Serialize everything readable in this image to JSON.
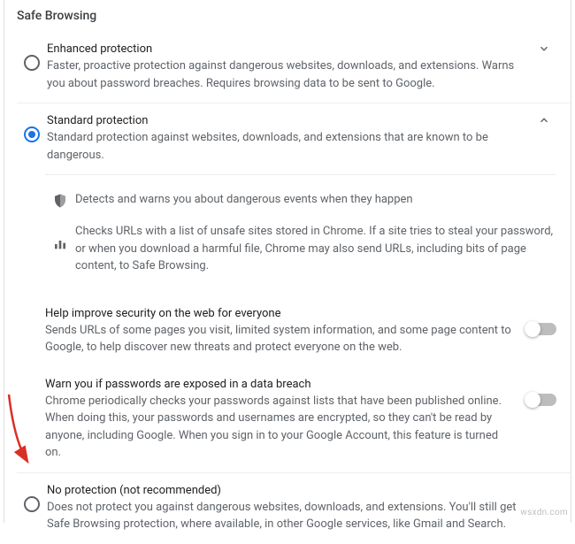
{
  "section_title": "Safe Browsing",
  "options": {
    "enhanced": {
      "title": "Enhanced protection",
      "desc": "Faster, proactive protection against dangerous websites, downloads, and extensions. Warns you about password breaches. Requires browsing data to be sent to Google."
    },
    "standard": {
      "title": "Standard protection",
      "desc": "Standard protection against websites, downloads, and extensions that are known to be dangerous."
    },
    "none": {
      "title": "No protection (not recommended)",
      "desc": "Does not protect you against dangerous websites, downloads, and extensions. You'll still get Safe Browsing protection, where available, in other Google services, like Gmail and Search."
    }
  },
  "standard_details": {
    "detects": "Detects and warns you about dangerous events when they happen",
    "checks": "Checks URLs with a list of unsafe sites stored in Chrome. If a site tries to steal your password, or when you download a harmful file, Chrome may also send URLs, including bits of page content, to Safe Browsing."
  },
  "sub": {
    "help": {
      "title": "Help improve security on the web for everyone",
      "desc": "Sends URLs of some pages you visit, limited system information, and some page content to Google, to help discover new threats and protect everyone on the web."
    },
    "warn": {
      "title": "Warn you if passwords are exposed in a data breach",
      "desc": "Chrome periodically checks your passwords against lists that have been published online. When doing this, your passwords and usernames are encrypted, so they can't be read by anyone, including Google. When you sign in to your Google Account, this feature is turned on."
    }
  },
  "watermark": "wsxdn.com"
}
